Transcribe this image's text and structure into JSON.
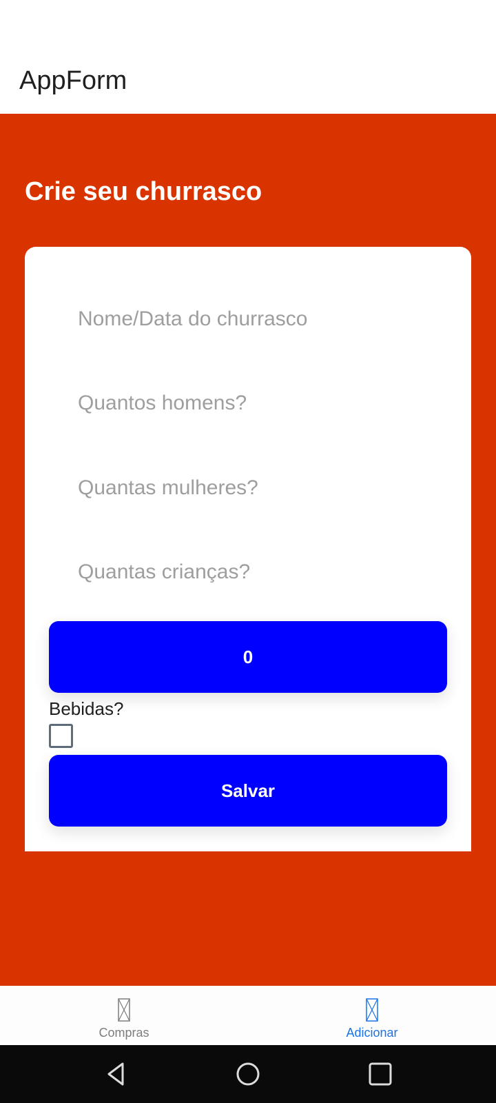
{
  "header": {
    "title": "AppForm"
  },
  "form": {
    "title": "Crie seu churrasco",
    "fields": {
      "name_placeholder": "Nome/Data do churrasco",
      "men_placeholder": "Quantos homens?",
      "women_placeholder": "Quantas mulheres?",
      "children_placeholder": "Quantas crianças?"
    },
    "counter_label": "0",
    "drinks_label": "Bebidas?",
    "drinks_checked": false,
    "save_label": "Salvar"
  },
  "bottom_nav": {
    "items": [
      {
        "label": "Compras",
        "icon": "placeholder-glyph-icon",
        "active": false
      },
      {
        "label": "Adicionar",
        "icon": "placeholder-glyph-icon",
        "active": true
      }
    ]
  },
  "system_nav": {
    "icons": [
      "back-icon",
      "home-icon",
      "recents-icon"
    ]
  },
  "colors": {
    "primary_background": "#d93400",
    "button": "#0000ff",
    "active_nav": "#1a73e8",
    "inactive_nav": "#7d7d7d"
  }
}
